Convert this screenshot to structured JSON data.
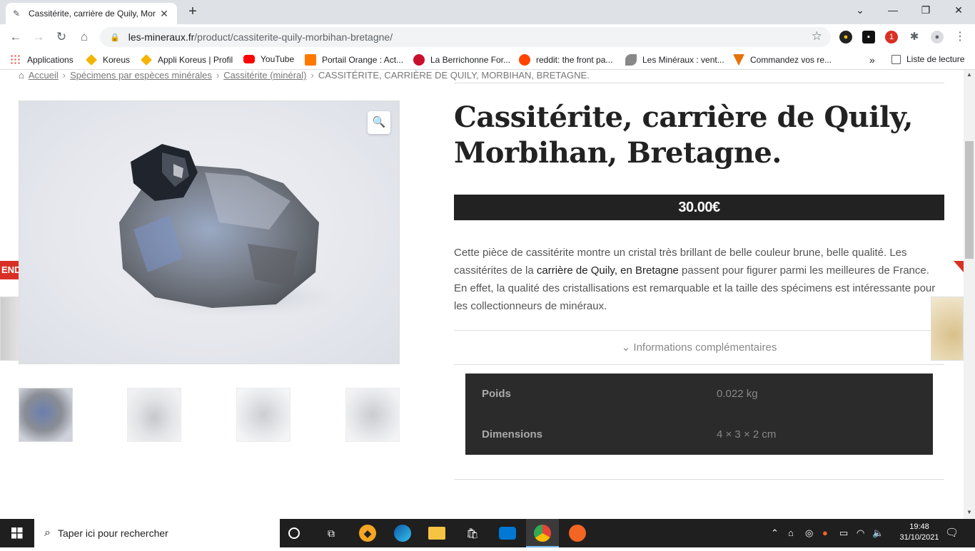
{
  "browser": {
    "tab_title": "Cassitérite, carrière de Quily, Mor",
    "url_host": "les-mineraux.fr",
    "url_path": "/product/cassiterite-quily-morbihan-bretagne/",
    "bookmarks": [
      {
        "label": "Applications",
        "color": "#4285f4"
      },
      {
        "label": "Koreus",
        "color": "#f4b400"
      },
      {
        "label": "Appli Koreus | Profil",
        "color": "#f4b400"
      },
      {
        "label": "YouTube",
        "color": "#ff0000"
      },
      {
        "label": "Portail Orange : Act...",
        "color": "#ff7900"
      },
      {
        "label": "La Berrichonne For...",
        "color": "#c8102e"
      },
      {
        "label": "reddit: the front pa...",
        "color": "#ff4500"
      },
      {
        "label": "Les Minéraux : vent...",
        "color": "#666666"
      },
      {
        "label": "Commandez vos re...",
        "color": "#e8710a"
      }
    ],
    "reading_list": "Liste de lecture",
    "overflow": "»"
  },
  "breadcrumb": {
    "home": "Accueil",
    "cat1": "Spécimens par espèces minérales",
    "cat2": "Cassitérite (minéral)",
    "current": "CASSITÉRITE, CARRIÈRE DE QUILY, MORBIHAN, BRETAGNE."
  },
  "product": {
    "title": "Cassitérite, carrière de Quily, Morbihan, Bretagne.",
    "price": "30.00€",
    "sold_badge": "ENDU",
    "description_before": "Cette pièce de cassitérite montre un cristal très brillant de belle couleur brune, belle qualité. Les cassitérites de la ",
    "description_link": "carrière de Quily, en Bretagne",
    "description_after": " passent pour figurer parmi les meilleures de France. En effet, la qualité des cristallisations est remarquable et la taille des spécimens est intéressante pour les collectionneurs de minéraux.",
    "info_toggle": "Informations complémentaires",
    "attributes": [
      {
        "key": "Poids",
        "value": "0.022 kg"
      },
      {
        "key": "Dimensions",
        "value": "4 × 3 × 2 cm"
      }
    ]
  },
  "taskbar": {
    "search_placeholder": "Taper ici pour rechercher",
    "time": "19:48",
    "date": "31/10/2021"
  }
}
